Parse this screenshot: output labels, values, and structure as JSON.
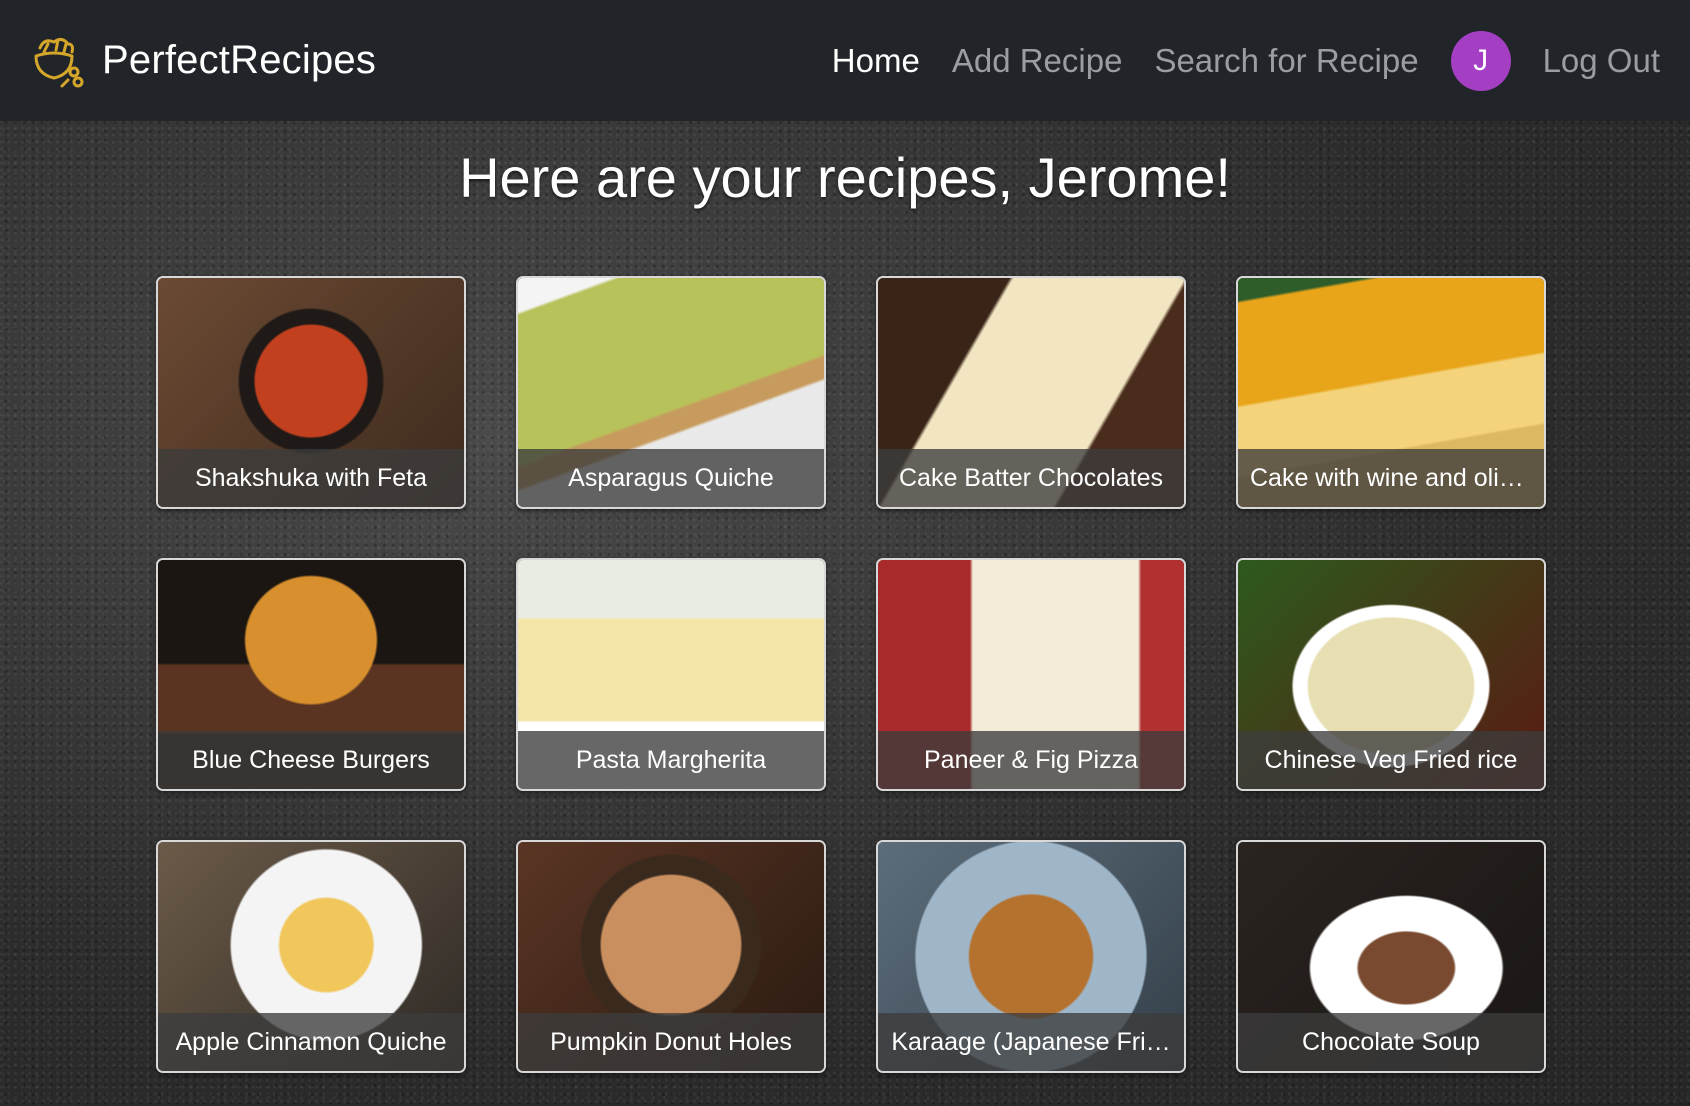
{
  "header": {
    "brand_name": "PerfectRecipes",
    "nav": {
      "home": "Home",
      "add_recipe": "Add Recipe",
      "search": "Search for Recipe",
      "avatar_initial": "J",
      "logout": "Log Out"
    },
    "colors": {
      "navbar_bg": "#212529",
      "avatar_bg": "#a43fc4",
      "logo": "#d4a62a"
    }
  },
  "main": {
    "heading": "Here are your recipes, Jerome!",
    "recipes": [
      {
        "title": "Shakshuka with Feta"
      },
      {
        "title": "Asparagus Quiche"
      },
      {
        "title": "Cake Batter Chocolates"
      },
      {
        "title": "Cake with wine and oliv…"
      },
      {
        "title": "Blue Cheese Burgers"
      },
      {
        "title": "Pasta Margherita"
      },
      {
        "title": "Paneer & Fig Pizza"
      },
      {
        "title": "Chinese Veg Fried rice"
      },
      {
        "title": "Apple Cinnamon Quiche"
      },
      {
        "title": "Pumpkin Donut Holes"
      },
      {
        "title": "Karaage (Japanese Fri…"
      },
      {
        "title": "Chocolate Soup"
      }
    ]
  }
}
